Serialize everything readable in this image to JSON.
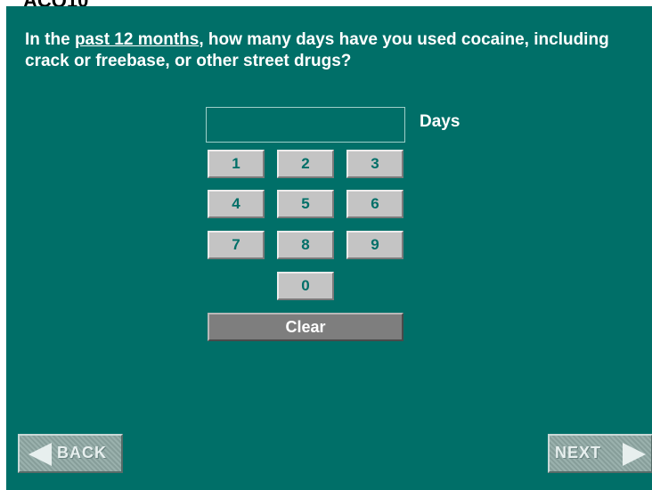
{
  "question": {
    "prefix": "In the ",
    "emphasis": "past 12 months",
    "suffix": ", how many days have you used cocaine, including crack or freebase, or other street drugs?"
  },
  "answer": {
    "value": "",
    "unit": "Days"
  },
  "keypad": {
    "keys": [
      "1",
      "2",
      "3",
      "4",
      "5",
      "6",
      "7",
      "8",
      "9",
      "0"
    ],
    "clear_label": "Clear"
  },
  "nav": {
    "back_label": "BACK",
    "next_label": "NEXT"
  },
  "colors": {
    "background": "#006f68",
    "key": "#c4c4c4",
    "key_text": "#006f68",
    "clear": "#7e7e7e",
    "text": "#ffffff"
  }
}
